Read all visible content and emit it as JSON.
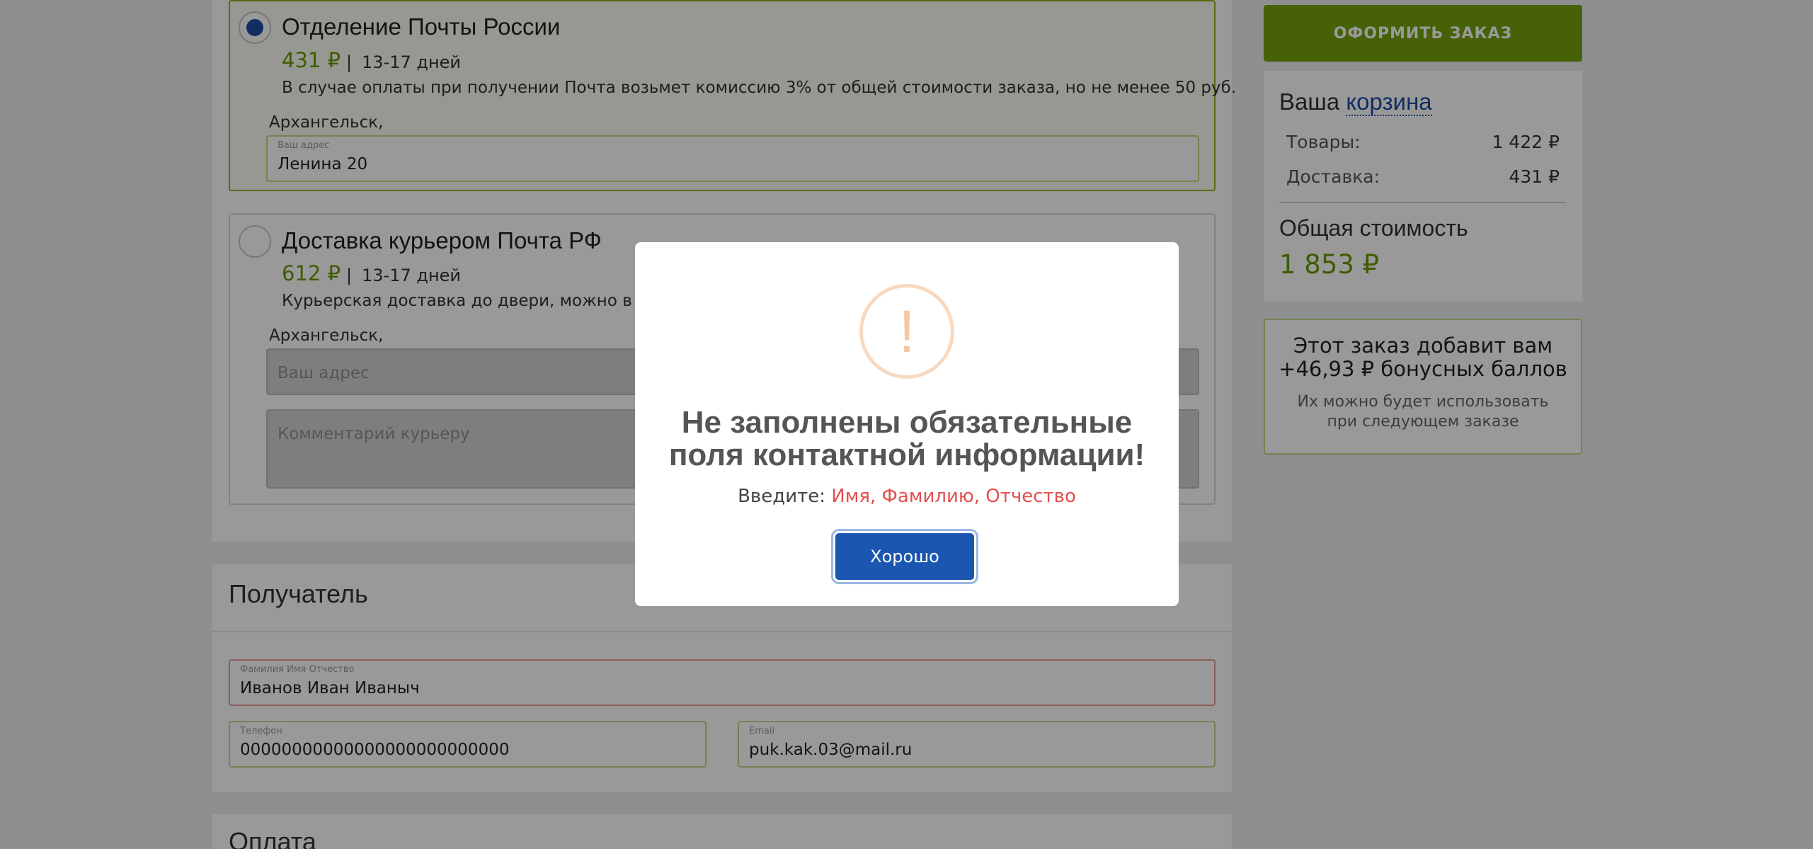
{
  "delivery": {
    "options": [
      {
        "title": "Отделение Почты России",
        "price": "431 ₽",
        "separator": "|",
        "days": "13-17 дней",
        "description": "В случае оплаты при получении Почта возьмет комиссию 3% от общей стоимости заказа, но не менее 50 руб.",
        "city": "Архангельск,",
        "address_label": "Ваш адрес",
        "address_value": "Ленина 20",
        "selected": true
      },
      {
        "title": "Доставка курьером Почта РФ",
        "price": "612 ₽",
        "separator": "|",
        "days": "13-17 дней",
        "description": "Курьерская доставка до двери, можно в вых",
        "city": "Архангельск,",
        "address_placeholder": "Ваш адрес",
        "comment_placeholder": "Комментарий курьеру",
        "selected": false
      }
    ]
  },
  "recipient": {
    "title": "Получатель",
    "fio_label": "Фамилия Имя Отчество",
    "fio_value": "Иванов Иван Иваныч",
    "phone_label": "Телефон",
    "phone_value": "00000000000000000000000000",
    "email_label": "Email",
    "email_value": "puk.kak.03@mail.ru"
  },
  "payment": {
    "title": "Оплата"
  },
  "checkout": {
    "button_label": "ОФОРМИТЬ ЗАКАЗ"
  },
  "cart": {
    "title_prefix": "Ваша",
    "title_link": "корзина",
    "goods_label": "Товары:",
    "goods_value": "1 422 ₽",
    "delivery_label": "Доставка:",
    "delivery_value": "431 ₽",
    "total_label": "Общая стоимость",
    "total_value": "1 853 ₽"
  },
  "bonus": {
    "line1": "Этот заказ добавит вам",
    "line2": "+46,93 ₽ бонусных баллов",
    "sub1": "Их можно будет использовать",
    "sub2": "при следующем заказе"
  },
  "modal": {
    "icon": "exclamation-icon",
    "title_line1": "Не заполнены обязательные",
    "title_line2": "поля контактной информации!",
    "prompt": "Введите:",
    "missing_fields": "Имя, Фамилию, Отчество",
    "ok_label": "Хорошо"
  },
  "colors": {
    "accent_green": "#76a20a",
    "price_green": "#6a9a00",
    "brand_blue": "#1b4fa0",
    "error_red": "#e05050"
  }
}
